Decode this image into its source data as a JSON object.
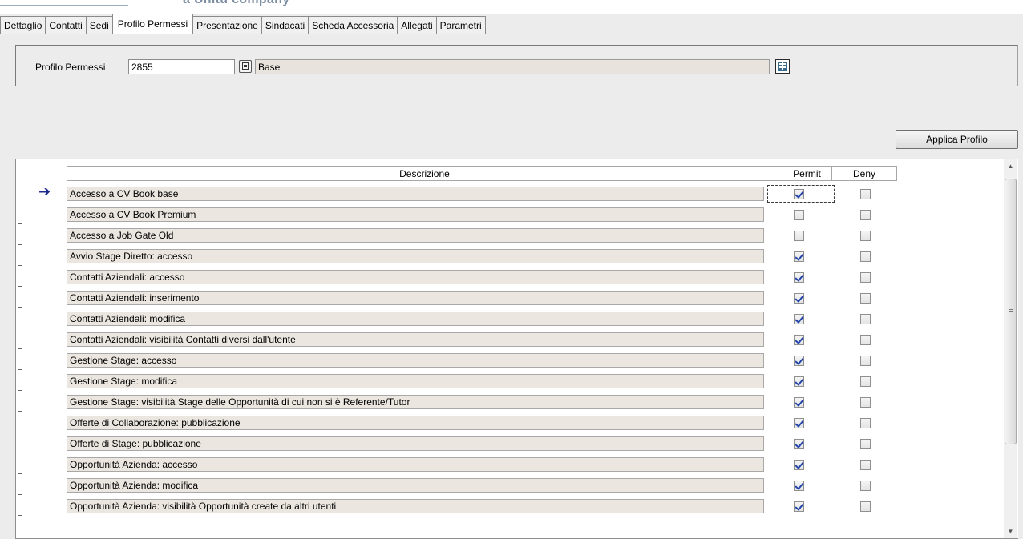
{
  "header_ghost_text": "a Unitu company",
  "tabs": [
    {
      "label": "Dettaglio",
      "active": false
    },
    {
      "label": "Contatti",
      "active": false
    },
    {
      "label": "Sedi",
      "active": false
    },
    {
      "label": "Profilo Permessi",
      "active": true
    },
    {
      "label": "Presentazione",
      "active": false
    },
    {
      "label": "Sindacati",
      "active": false
    },
    {
      "label": "Scheda Accessoria",
      "active": false
    },
    {
      "label": "Allegati",
      "active": false
    },
    {
      "label": "Parametri",
      "active": false
    }
  ],
  "profilo": {
    "label": "Profilo Permessi",
    "code": "2855",
    "description": "Base",
    "lookup_icon": "lookup-icon",
    "calc_icon": "calculator-icon"
  },
  "apply_button": "Applica Profilo",
  "grid": {
    "columns": {
      "description": "Descrizione",
      "permit": "Permit",
      "deny": "Deny"
    },
    "current_row_icon": "arrow-right-icon",
    "rows": [
      {
        "description": "Accesso a CV Book base",
        "permit": true,
        "deny": false,
        "current": true
      },
      {
        "description": "Accesso a CV Book Premium",
        "permit": false,
        "deny": false
      },
      {
        "description": "Accesso a Job Gate Old",
        "permit": false,
        "deny": false
      },
      {
        "description": "Avvio Stage Diretto: accesso",
        "permit": true,
        "deny": false
      },
      {
        "description": "Contatti Aziendali: accesso",
        "permit": true,
        "deny": false
      },
      {
        "description": "Contatti Aziendali: inserimento",
        "permit": true,
        "deny": false
      },
      {
        "description": "Contatti Aziendali: modifica",
        "permit": true,
        "deny": false
      },
      {
        "description": "Contatti Aziendali: visibilità Contatti diversi dall'utente",
        "permit": true,
        "deny": false
      },
      {
        "description": "Gestione Stage: accesso",
        "permit": true,
        "deny": false
      },
      {
        "description": "Gestione Stage: modifica",
        "permit": true,
        "deny": false
      },
      {
        "description": "Gestione Stage: visibilità Stage delle Opportunità di cui non si è Referente/Tutor",
        "permit": true,
        "deny": false
      },
      {
        "description": "Offerte di Collaborazione: pubblicazione",
        "permit": true,
        "deny": false
      },
      {
        "description": "Offerte di Stage: pubblicazione",
        "permit": true,
        "deny": false
      },
      {
        "description": "Opportunità Azienda: accesso",
        "permit": true,
        "deny": false
      },
      {
        "description": "Opportunità Azienda: modifica",
        "permit": true,
        "deny": false
      },
      {
        "description": "Opportunità Azienda: visibilità Opportunità create da altri utenti",
        "permit": true,
        "deny": false
      }
    ]
  },
  "colors": {
    "accent": "#1c2a8c",
    "field_bg": "#ebe6e0",
    "panel_bg": "#ececec"
  }
}
